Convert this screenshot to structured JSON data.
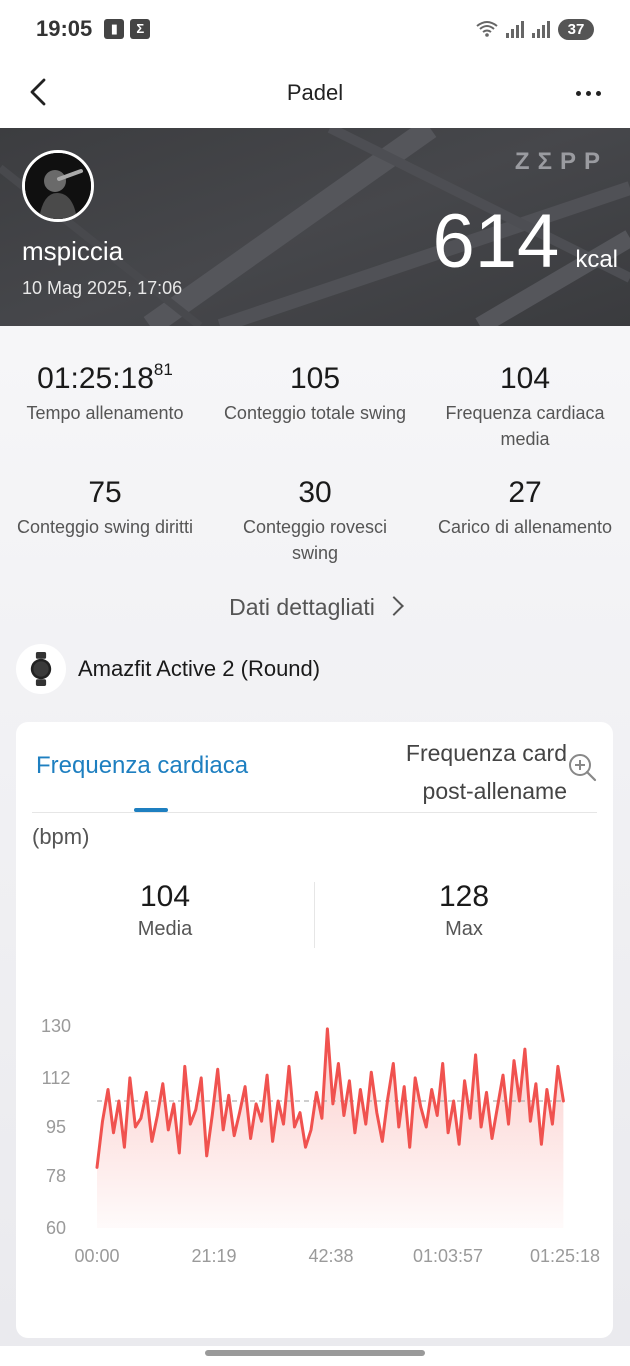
{
  "status_bar": {
    "time": "19:05",
    "notifications": [
      "notification-icon",
      "sigma-icon"
    ],
    "battery": "37"
  },
  "header": {
    "title": "Padel"
  },
  "banner": {
    "username": "mspiccia",
    "date": "10 Mag 2025, 17:06",
    "brand": "ZΣPP",
    "calories_value": "614",
    "calories_unit": "kcal"
  },
  "stats": [
    {
      "value": "01:25:18",
      "value_sup": "81",
      "label": "Tempo allenamento"
    },
    {
      "value": "105",
      "label": "Conteggio totale swing"
    },
    {
      "value": "104",
      "label": "Frequenza cardiaca media"
    },
    {
      "value": "75",
      "label": "Conteggio swing diritti"
    },
    {
      "value": "30",
      "label": "Conteggio rovesci swing"
    },
    {
      "value": "27",
      "label": "Carico di allenamento"
    }
  ],
  "details_link": "Dati dettagliati",
  "device": {
    "name": "Amazfit Active 2 (Round)"
  },
  "hr_card": {
    "tab_active": "Frequenza cardiaca",
    "tab_inactive": "Frequenza card post-allename",
    "unit": "(bpm)",
    "avg_value": "104",
    "avg_label": "Media",
    "max_value": "128",
    "max_label": "Max"
  },
  "chart_data": {
    "type": "area",
    "title": "",
    "xlabel": "",
    "ylabel": "(bpm)",
    "y_ticks": [
      130,
      112,
      95,
      78,
      60
    ],
    "ylim": [
      60,
      130
    ],
    "x_ticks": [
      "00:00",
      "21:19",
      "42:38",
      "01:03:57",
      "01:25:18"
    ],
    "xlim_minutes": [
      0,
      85.3
    ],
    "average_line": 104,
    "line_color": "#f0524f",
    "fill_color": "#fbc7c5",
    "series": [
      {
        "x_minutes": [
          0,
          1,
          2,
          3,
          4,
          5,
          6,
          7,
          8,
          9,
          10,
          11,
          12,
          13,
          14,
          15,
          16,
          17,
          18,
          19,
          20,
          21,
          22,
          23,
          24,
          25,
          26,
          27,
          28,
          29,
          30,
          31,
          32,
          33,
          34,
          35,
          36,
          37,
          38,
          39,
          40,
          41,
          42,
          43,
          44,
          45,
          46,
          47,
          48,
          49,
          50,
          51,
          52,
          53,
          54,
          55,
          56,
          57,
          58,
          59,
          60,
          61,
          62,
          63,
          64,
          65,
          66,
          67,
          68,
          69,
          70,
          71,
          72,
          73,
          74,
          75,
          76,
          77,
          78,
          79,
          80,
          81,
          82,
          83,
          84,
          85
        ],
        "values": [
          81,
          97,
          108,
          93,
          104,
          88,
          112,
          95,
          98,
          107,
          90,
          99,
          110,
          94,
          103,
          86,
          116,
          96,
          101,
          112,
          85,
          99,
          115,
          94,
          106,
          92,
          100,
          109,
          91,
          103,
          97,
          113,
          90,
          104,
          96,
          116,
          95,
          100,
          88,
          94,
          107,
          98,
          129,
          103,
          117,
          99,
          111,
          93,
          108,
          96,
          114,
          100,
          90,
          105,
          117,
          95,
          109,
          88,
          112,
          102,
          95,
          108,
          99,
          117,
          93,
          104,
          89,
          111,
          98,
          120,
          95,
          107,
          91,
          102,
          113,
          96,
          118,
          104,
          122,
          97,
          110,
          89,
          108,
          96,
          116,
          104
        ],
        "name": ""
      }
    ]
  }
}
